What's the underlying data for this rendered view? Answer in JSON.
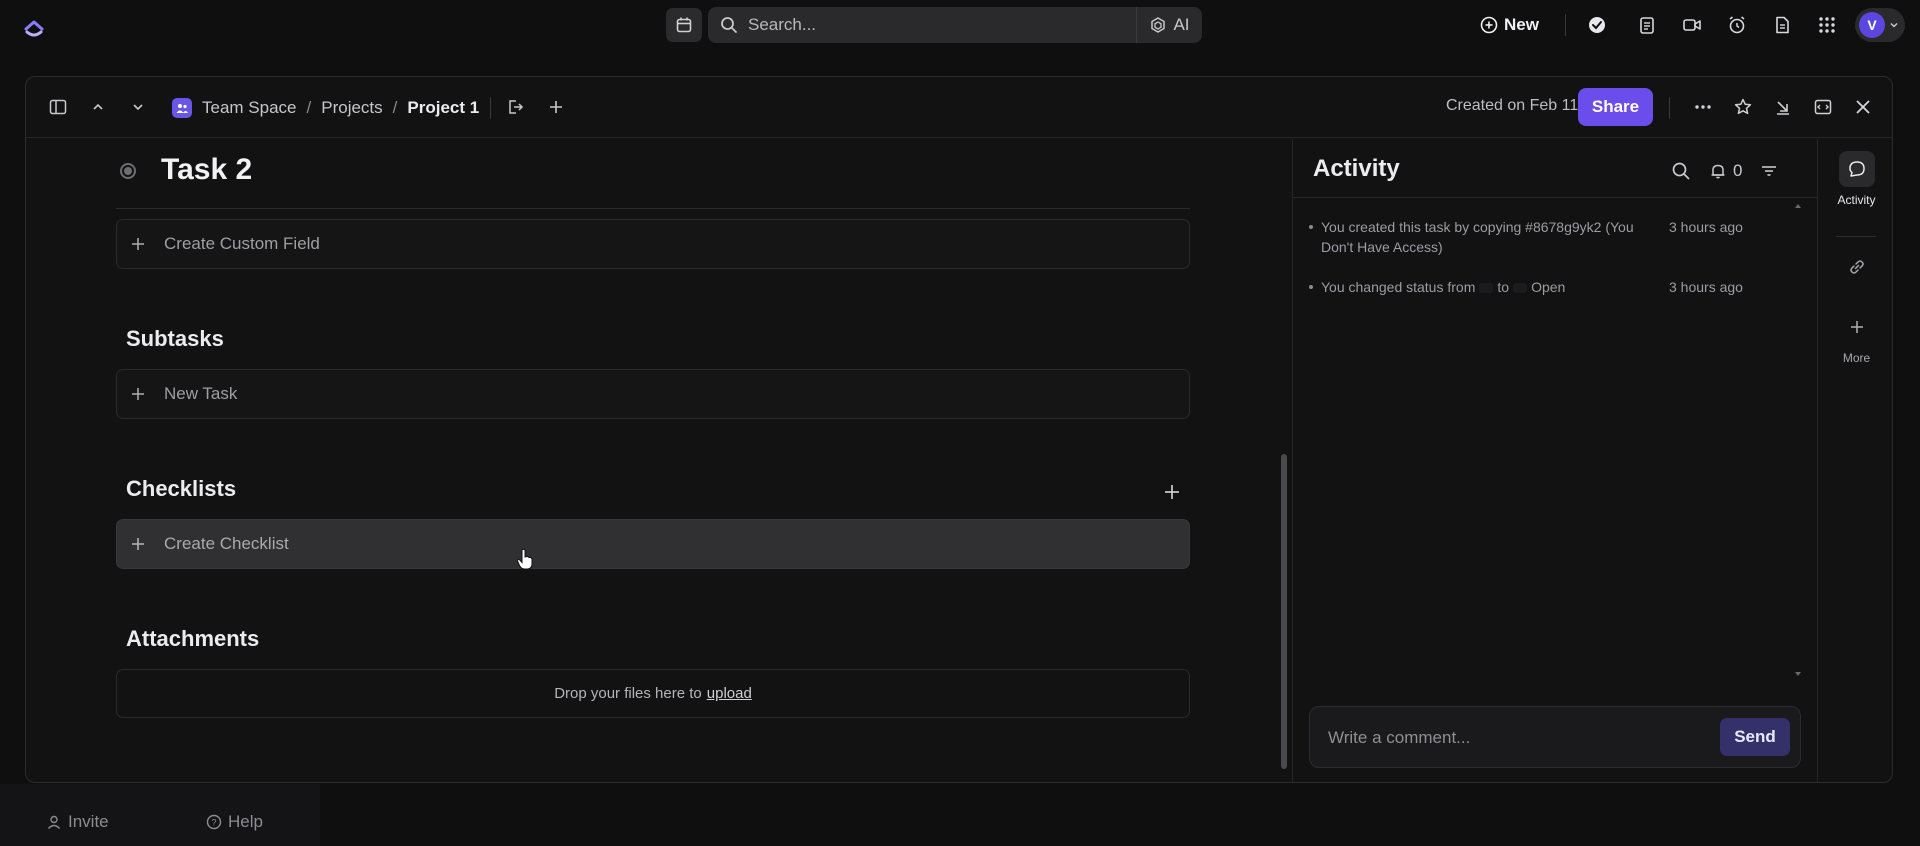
{
  "topbar": {
    "search_placeholder": "Search...",
    "ai_label": "AI",
    "new_label": "New",
    "avatar_initial": "V"
  },
  "background": {
    "invite_label": "Invite",
    "help_label": "Help"
  },
  "breadcrumb": {
    "space": "Team Space",
    "folder": "Projects",
    "list": "Project 1",
    "separator": "/"
  },
  "header": {
    "created": "Created on Feb 11",
    "share_label": "Share"
  },
  "task": {
    "title": "Task 2",
    "create_custom_field": "Create Custom Field"
  },
  "sections": {
    "subtasks": "Subtasks",
    "new_task": "New Task",
    "checklists": "Checklists",
    "create_checklist": "Create Checklist",
    "attachments": "Attachments",
    "drop_text": "Drop your files here to",
    "upload_link": "upload"
  },
  "activity": {
    "title": "Activity",
    "notification_count": "0",
    "items": [
      {
        "text": "You created this task by copying #8678g9yk2 (You Don't Have Access)",
        "time": "3 hours ago"
      },
      {
        "text_pre": "You changed status from",
        "text_mid": "to",
        "text_post": "Open",
        "time": "3 hours ago"
      }
    ],
    "comment_placeholder": "Write a comment...",
    "send_label": "Send"
  },
  "rail": {
    "activity_label": "Activity",
    "more_label": "More"
  },
  "colors": {
    "accent": "#6a4dea",
    "background": "#121213",
    "avatar": "#5b47e0"
  }
}
